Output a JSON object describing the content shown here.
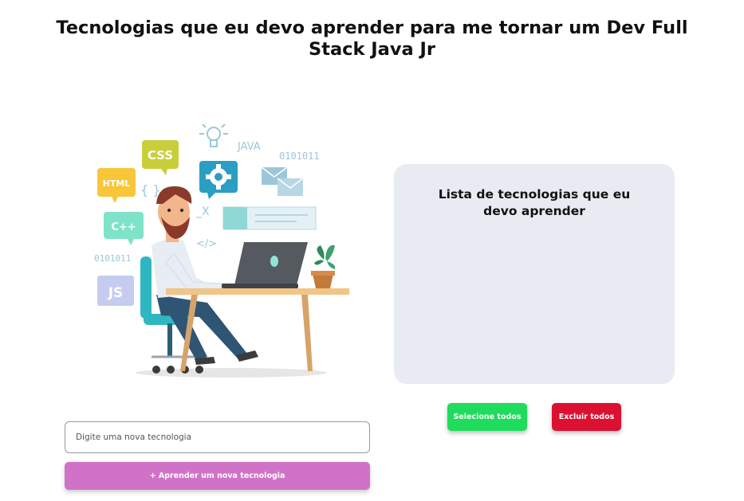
{
  "page": {
    "title": "Tecnologias que eu devo aprender para me tornar um Dev Full Stack Java Jr"
  },
  "illustration": {
    "labels": {
      "css": "CSS",
      "html": "HTML",
      "cpp": "C++",
      "js": "JS",
      "java": "JAVA",
      "binary_top": "0101011",
      "binary_left": "0101011",
      "braces": "{ }",
      "slash_tag": "</>",
      "x_mark": "_X"
    }
  },
  "list": {
    "title": "Lista de tecnologias que eu devo aprender",
    "items": []
  },
  "actions": {
    "select_all_label": "Selecione todos",
    "delete_all_label": "Excluir todos"
  },
  "form": {
    "input_placeholder": "Digite uma nova tecnologia",
    "input_value": "",
    "add_label": "+ Aprender um nova tecnologia"
  },
  "colors": {
    "select_all": "#1fdc5d",
    "delete_all": "#dc1131",
    "add_button": "#d073c8",
    "panel_bg": "#e8ebf2"
  }
}
